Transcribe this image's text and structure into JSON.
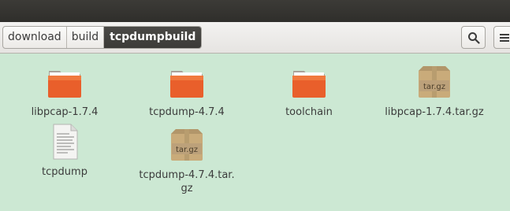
{
  "pathbar": {
    "crumbs": [
      "download",
      "build"
    ],
    "current": "tcpdumpbuild"
  },
  "toolbar": {
    "search_icon": "search-icon",
    "menu_icon": "hamburger-menu-icon"
  },
  "colors": {
    "background": "#cce8d3",
    "folder_orange": "#e95f2b",
    "archive_tan": "#c9ab7a"
  },
  "files": [
    {
      "name": "libpcap-1.7.4",
      "type": "folder"
    },
    {
      "name": "tcpdump-4.7.4",
      "type": "folder"
    },
    {
      "name": "toolchain",
      "type": "folder"
    },
    {
      "name": "libpcap-1.7.4.tar.gz",
      "type": "archive",
      "badge": "tar.gz"
    },
    {
      "name": "tcpdump",
      "type": "text"
    },
    {
      "name": "tcpdump-4.7.4.tar.\ngz",
      "type": "archive",
      "badge": "tar.gz"
    }
  ]
}
